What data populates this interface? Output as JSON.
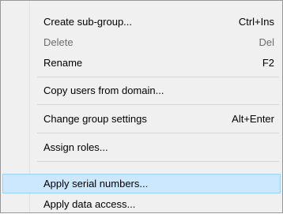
{
  "menu": {
    "items": [
      {
        "label": "Create sub-group...",
        "shortcut": "Ctrl+Ins",
        "enabled": true
      },
      {
        "label": "Delete",
        "shortcut": "Del",
        "enabled": false
      },
      {
        "label": "Rename",
        "shortcut": "F2",
        "enabled": true
      },
      {
        "label": "Copy users from domain...",
        "shortcut": "",
        "enabled": true
      },
      {
        "label": "Change group settings",
        "shortcut": "Alt+Enter",
        "enabled": true
      },
      {
        "label": "Assign roles...",
        "shortcut": "",
        "enabled": true
      },
      {
        "label": "Apply serial numbers...",
        "shortcut": "",
        "enabled": true,
        "highlighted": true
      },
      {
        "label": "Apply data access...",
        "shortcut": "",
        "enabled": true
      }
    ]
  },
  "colors": {
    "menu_background": "#f0f0f0",
    "highlight_background": "#cce8ff",
    "highlight_border": "#99d1ff",
    "disabled_text": "#6d6d6d",
    "separator": "#d7d7d7"
  }
}
